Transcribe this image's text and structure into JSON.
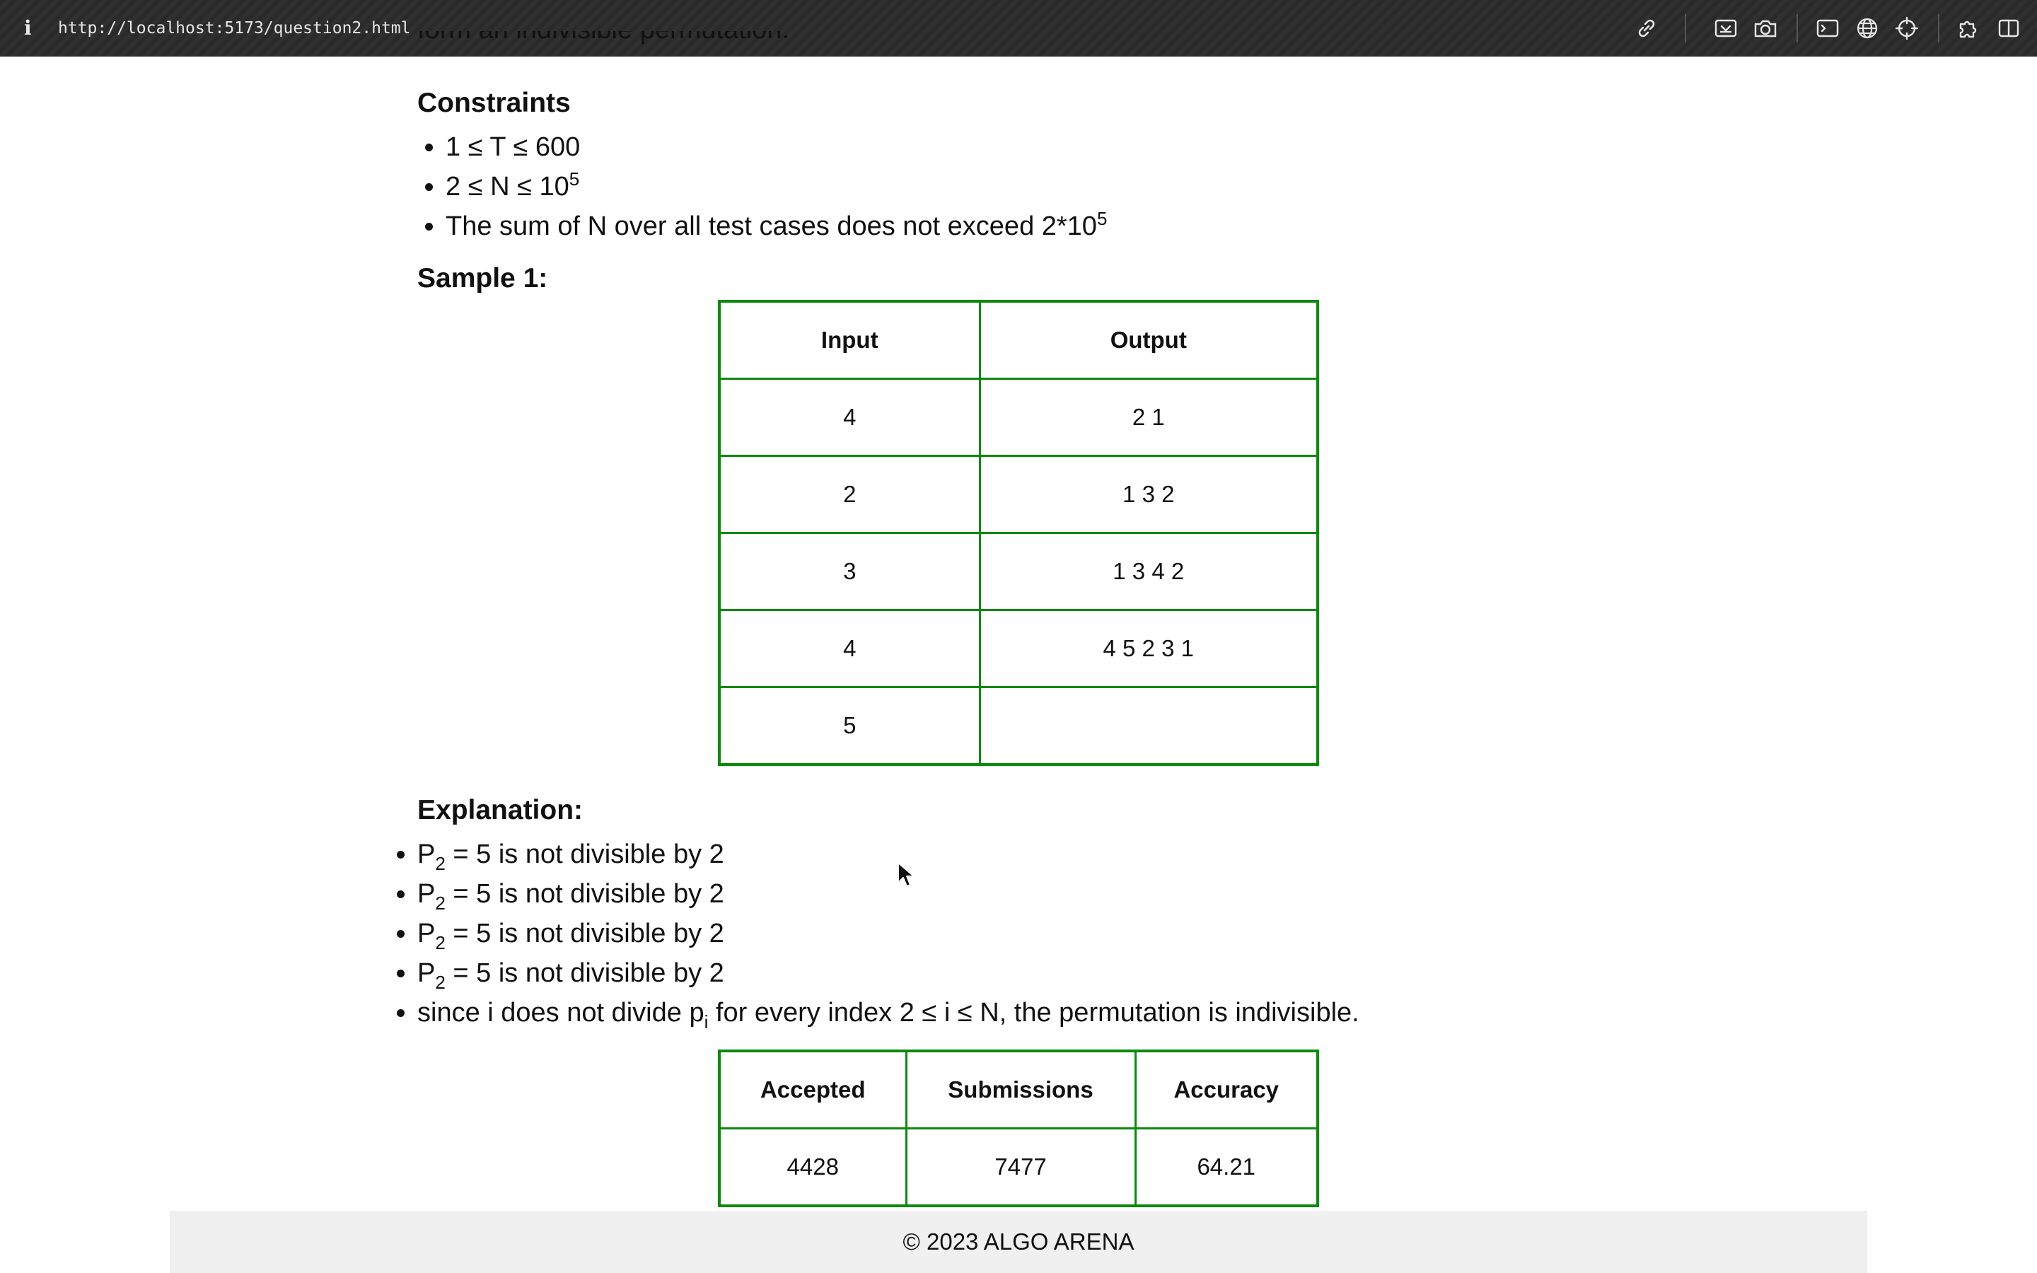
{
  "browser": {
    "url": "http://localhost:5173/question2.html"
  },
  "page": {
    "clipped_text": "form an indivisible permutation.",
    "constraints": {
      "heading": "Constraints",
      "items": [
        {
          "text": "1 ≤ T ≤ 600"
        },
        {
          "base": "2 ≤ N ≤ 10",
          "sup": "5"
        },
        {
          "base": "The sum of N over all test cases does not exceed 2*10",
          "sup": "5"
        }
      ]
    },
    "sample": {
      "heading": "Sample 1:",
      "table": {
        "headers": [
          "Input",
          "Output"
        ],
        "rows": [
          [
            "4",
            "2 1"
          ],
          [
            "2",
            "1 3 2"
          ],
          [
            "3",
            "1 3 4 2"
          ],
          [
            "4",
            "4 5 2 3 1"
          ],
          [
            "5",
            ""
          ]
        ]
      }
    },
    "explanation": {
      "heading": "Explanation:",
      "items": [
        {
          "pre": "P",
          "sub": "2",
          "post": " = 5 is not divisible by 2"
        },
        {
          "pre": "P",
          "sub": "2",
          "post": " = 5 is not divisible by 2"
        },
        {
          "pre": "P",
          "sub": "2",
          "post": " = 5 is not divisible by 2"
        },
        {
          "pre": "P",
          "sub": "2",
          "post": " = 5 is not divisible by 2"
        },
        {
          "pre": "since i does not divide p",
          "sub": "i",
          "post": " for every index 2 ≤ i ≤ N, the permutation is indivisible."
        }
      ]
    },
    "stats": {
      "headers": [
        "Accepted",
        "Submissions",
        "Accuracy"
      ],
      "values": [
        "4428",
        "7477",
        "64.21"
      ]
    },
    "footer": "© 2023 ALGO ARENA"
  },
  "icons": [
    "link-icon",
    "screenshot-area-icon",
    "camera-icon",
    "terminal-icon",
    "globe-icon",
    "crosshair-icon",
    "extensions-icon",
    "sidebar-icon"
  ],
  "colors": {
    "table_border": "#0b8a0b",
    "footer_bg": "#f0f0f0",
    "topbar_bg": "#2a2a2a"
  }
}
